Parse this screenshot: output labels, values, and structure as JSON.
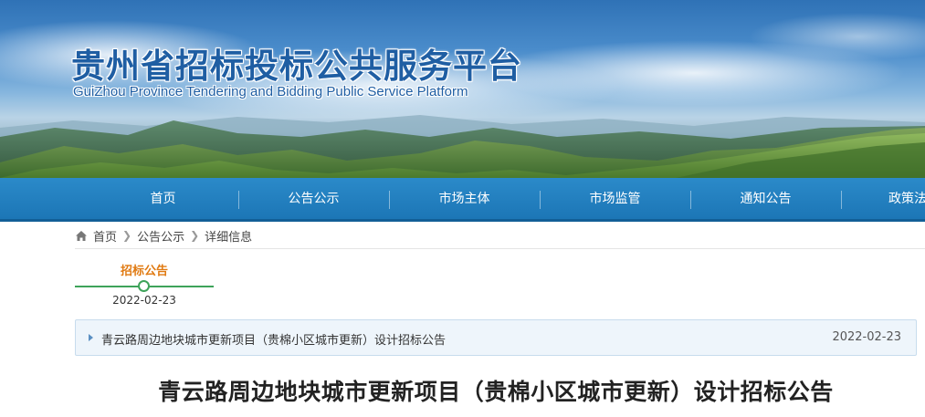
{
  "header": {
    "title": "贵州省招标投标公共服务平台",
    "subtitle": "GuiZhou Province Tendering and Bidding Public Service Platform"
  },
  "nav": {
    "items": [
      "首页",
      "公告公示",
      "市场主体",
      "市场监管",
      "通知公告",
      "政策法"
    ]
  },
  "breadcrumb": {
    "home_icon": "home-icon",
    "items": [
      "首页",
      "公告公示",
      "详细信息"
    ]
  },
  "timeline": {
    "label": "招标公告",
    "date": "2022-02-23"
  },
  "list": {
    "items": [
      {
        "title": "青云路周边地块城市更新项目（贵棉小区城市更新）设计招标公告",
        "date": "2022-02-23"
      }
    ]
  },
  "article": {
    "title": "青云路周边地块城市更新项目（贵棉小区城市更新）设计招标公告"
  },
  "colors": {
    "nav_bg": "#1c76b6",
    "title_blue": "#1f5ea3",
    "timeline_green": "#3ea35a",
    "timeline_orange": "#e07a12"
  }
}
